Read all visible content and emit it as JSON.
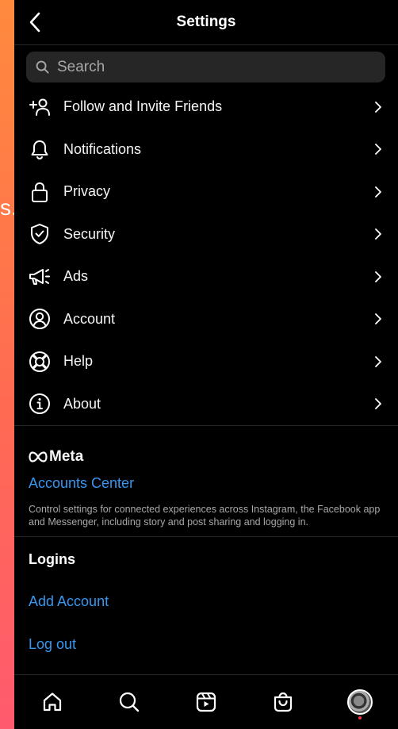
{
  "background_text": "s.",
  "header": {
    "title": "Settings"
  },
  "search": {
    "placeholder": "Search"
  },
  "menu": [
    {
      "label": "Follow and Invite Friends",
      "icon": "add-person-icon"
    },
    {
      "label": "Notifications",
      "icon": "bell-icon"
    },
    {
      "label": "Privacy",
      "icon": "lock-icon"
    },
    {
      "label": "Security",
      "icon": "shield-check-icon"
    },
    {
      "label": "Ads",
      "icon": "megaphone-icon"
    },
    {
      "label": "Account",
      "icon": "user-circle-icon"
    },
    {
      "label": "Help",
      "icon": "lifebuoy-icon"
    },
    {
      "label": "About",
      "icon": "info-icon"
    }
  ],
  "meta": {
    "logo_text": "Meta",
    "accounts_center": "Accounts Center",
    "description": "Control settings for connected experiences across Instagram, the Facebook app and Messenger, including story and post sharing and logging in."
  },
  "logins": {
    "title": "Logins",
    "add_account": "Add Account",
    "log_out": "Log out"
  },
  "bottom_nav": [
    "home-icon",
    "search-icon",
    "reels-icon",
    "shop-icon",
    "profile-avatar"
  ],
  "colors": {
    "link": "#3797f0",
    "background": "#000000",
    "divider": "#262626",
    "notification_dot": "#ff3040"
  }
}
